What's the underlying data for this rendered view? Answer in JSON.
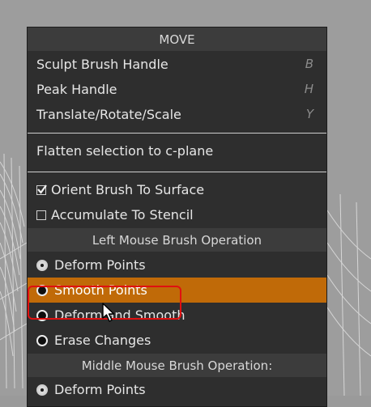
{
  "menu": {
    "title": "MOVE",
    "group1": [
      {
        "label": "Sculpt Brush Handle",
        "shortcut": "B"
      },
      {
        "label": "Peak Handle",
        "shortcut": "H"
      },
      {
        "label": "Translate/Rotate/Scale",
        "shortcut": "Y"
      }
    ],
    "flatten": "Flatten selection to c-plane",
    "checkboxes": [
      {
        "label": "Orient Brush To Surface",
        "checked": true
      },
      {
        "label": "Accumulate To Stencil",
        "checked": false
      }
    ],
    "left_section": "Left Mouse Brush Operation",
    "left_options": [
      {
        "label": "Deform Points",
        "selected": true
      },
      {
        "label": "Smooth Points",
        "selected": false,
        "highlighted": true
      },
      {
        "label": "Deform and Smooth",
        "selected": false
      },
      {
        "label": "Erase Changes",
        "selected": false
      }
    ],
    "middle_section": "Middle Mouse Brush Operation:",
    "middle_options": [
      {
        "label": "Deform Points"
      }
    ]
  },
  "colors": {
    "highlight": "#c06a08",
    "annotation": "#e01010",
    "menu_bg": "#2e2e2e"
  }
}
